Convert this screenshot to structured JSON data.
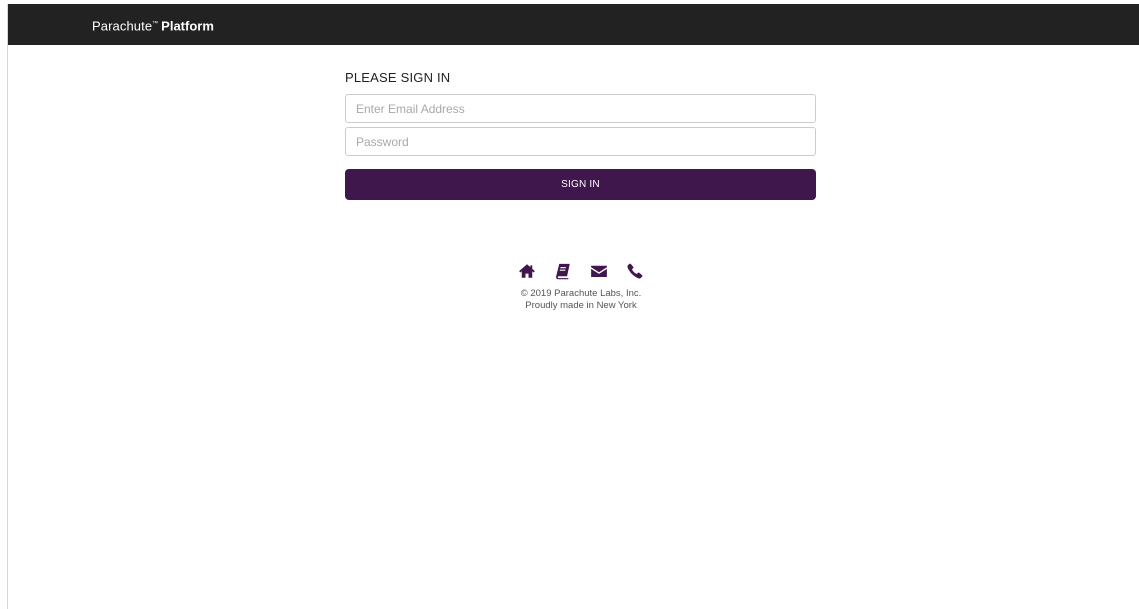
{
  "header": {
    "logo_light": "Parachute",
    "logo_tm": "™",
    "logo_bold": "Platform"
  },
  "signin": {
    "title": "PLEASE SIGN IN",
    "email_placeholder": "Enter Email Address",
    "email_value": "",
    "password_placeholder": "Password",
    "password_value": "",
    "button_label": "SIGN IN"
  },
  "footer": {
    "icons": [
      "home-icon",
      "book-icon",
      "envelope-icon",
      "phone-icon"
    ],
    "copyright": "© 2019 Parachute Labs, Inc.",
    "tagline": "Proudly made in New York"
  },
  "colors": {
    "topbar": "#222222",
    "accent": "#3f174d",
    "background": "#ffffff"
  }
}
